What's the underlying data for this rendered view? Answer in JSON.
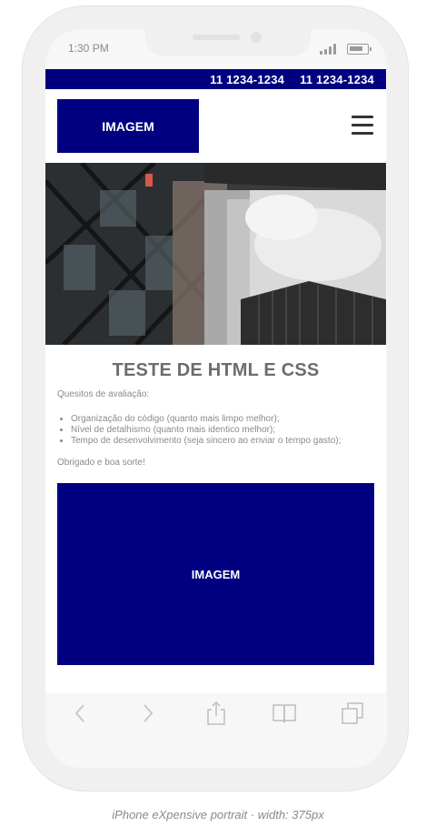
{
  "status": {
    "time": "1:30 PM"
  },
  "topbar": {
    "phones": [
      "11 1234-1234",
      "11 1234-1234"
    ]
  },
  "header": {
    "logo_label": "IMAGEM"
  },
  "main": {
    "title": "TESTE DE HTML E CSS",
    "subtitle": "Quesitos de avaliação:",
    "criteria": [
      "Organização do código (quanto mais limpo melhor);",
      "Nível de detalhismo (quanto mais identico melhor);",
      "Tempo de desenvolvimento (seja sincero ao enviar o tempo gasto);"
    ],
    "thanks": "Obrigado e boa sorte!",
    "image_label": "IMAGEM"
  },
  "colors": {
    "brand": "#000080",
    "text_muted": "#8a8a8a",
    "title": "#6d6d6d"
  },
  "toolbar": {
    "icons": [
      "back-arrow-icon",
      "forward-arrow-icon",
      "share-icon",
      "bookmarks-icon",
      "tabs-icon"
    ]
  },
  "caption": "iPhone eXpensive portrait · width: 375px"
}
